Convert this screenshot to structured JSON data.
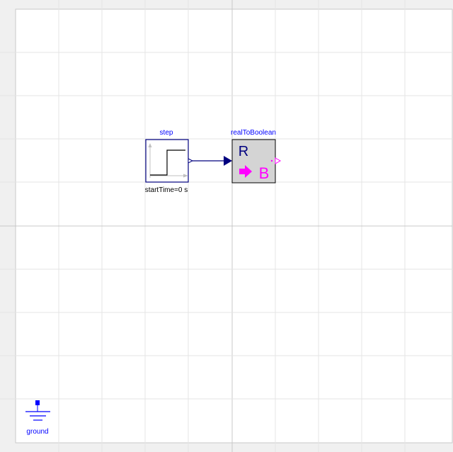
{
  "diagram": {
    "components": {
      "step": {
        "name": "step",
        "parameter": "startTime=0 s",
        "icon": "step-function-icon"
      },
      "real_to_boolean": {
        "name": "realToBoolean",
        "input_letter": "R",
        "output_letter": "B",
        "icon": "real-to-boolean-icon"
      },
      "ground": {
        "name": "ground",
        "icon": "ground-icon"
      }
    },
    "connection": {
      "from": "step",
      "to": "realToBoolean"
    },
    "colors": {
      "background": "#ffffff",
      "outer_area": "#f0f0f0",
      "grid_minor": "#e4e4e4",
      "grid_major": "#c8c8c8",
      "label_blue": "#0000ff",
      "step_border": "#00007f",
      "connector_line": "#00007f",
      "block_fill": "#d4d4d4",
      "magenta": "#ff00ff"
    }
  }
}
